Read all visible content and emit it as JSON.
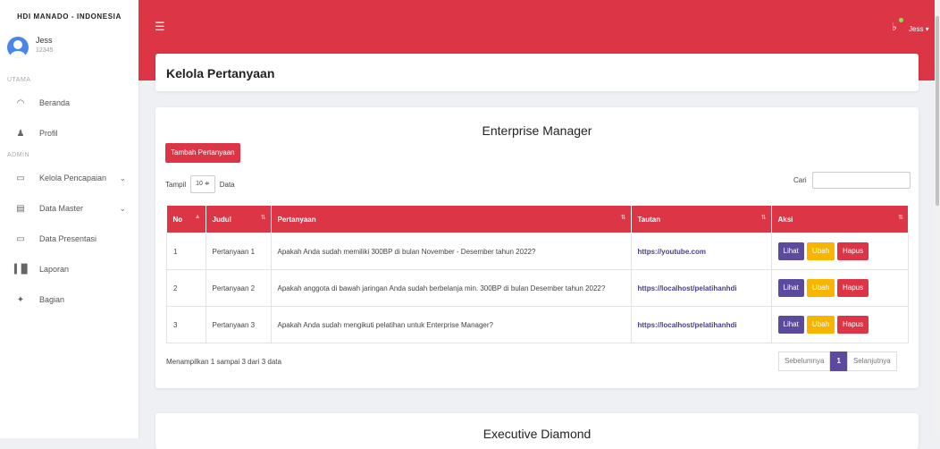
{
  "sidebar": {
    "brand": "HDI MANADO - INDONESIA",
    "user": {
      "name": "Jess",
      "id": "12345"
    },
    "sections": {
      "main": "UTAMA",
      "admin": "ADMIN"
    },
    "items": [
      {
        "label": "Beranda",
        "icon": "gauge-icon"
      },
      {
        "label": "Profil",
        "icon": "user-icon"
      },
      {
        "label": "Kelola Pencapaian",
        "icon": "folder-icon"
      },
      {
        "label": "Data Master",
        "icon": "book-icon"
      },
      {
        "label": "Data Presentasi",
        "icon": "monitor-icon"
      },
      {
        "label": "Laporan",
        "icon": "chart-icon"
      },
      {
        "label": "Bagian",
        "icon": "tools-icon"
      }
    ]
  },
  "topbar": {
    "user": "Jess ▾"
  },
  "page": {
    "title": "Kelola Pertanyaan"
  },
  "card": {
    "title": "Enterprise Manager",
    "add_button": "Tambah Pertanyaan",
    "show_prefix": "Tampil",
    "show_value": "10 ≑",
    "show_suffix": "Data",
    "search_label": "Cari",
    "columns": [
      "No",
      "Judul",
      "Pertanyaan",
      "Tautan",
      "Aksi"
    ],
    "rows": [
      {
        "no": "1",
        "judul": "Pertanyaan 1",
        "pertanyaan": "Apakah Anda sudah memiliki 300BP di bulan November - Desember tahun 2022?",
        "tautan": "https://youtube.com"
      },
      {
        "no": "2",
        "judul": "Pertanyaan 2",
        "pertanyaan": "Apakah anggota di bawah jaringan Anda sudah berbelanja min. 300BP di bulan Desember tahun 2022?",
        "tautan": "https://localhost/pelatihanhdi"
      },
      {
        "no": "3",
        "judul": "Pertanyaan 3",
        "pertanyaan": "Apakah Anda sudah mengikuti pelatihan untuk Enterprise Manager?",
        "tautan": "https://localhost/pelatihanhdi"
      }
    ],
    "actions": {
      "view": "Lihat",
      "edit": "Ubah",
      "delete": "Hapus"
    },
    "info": "Menampilkan 1 sampai 3 dari 3 data",
    "pager": {
      "prev": "Sebelumnya",
      "current": "1",
      "next": "Selanjutnya"
    }
  },
  "card2": {
    "title": "Executive Diamond"
  },
  "colors": {
    "primary": "#dc3545",
    "view": "#5b4a9e",
    "edit": "#f7b500"
  }
}
